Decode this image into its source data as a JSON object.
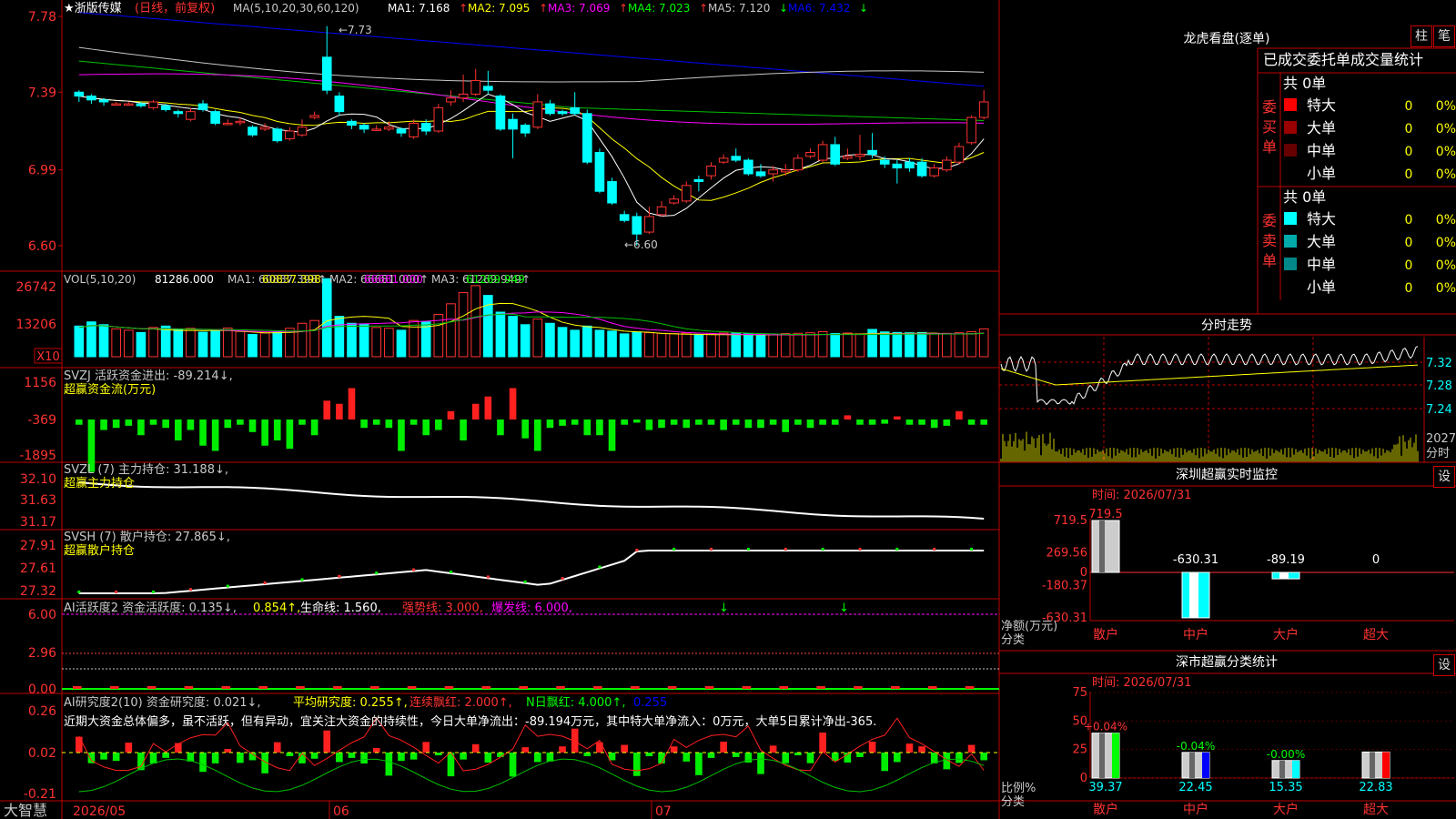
{
  "app": {
    "name": "大智慧"
  },
  "main": {
    "stock_star": "★",
    "stock_name": "浙版传媒",
    "period": "(日线，前复权)",
    "ma_label": "MA(5,10,20,30,60,120)",
    "ma": [
      {
        "name": "MA1",
        "value": "7.168",
        "arrow": "↑",
        "color": "#ffffff"
      },
      {
        "name": "MA2",
        "value": "7.095",
        "arrow": "↑",
        "color": "#ffff00"
      },
      {
        "name": "MA3",
        "value": "7.069",
        "arrow": "↑",
        "color": "#ff00ff"
      },
      {
        "name": "MA4",
        "value": "7.023",
        "arrow": "↑",
        "color": "#00ff00"
      },
      {
        "name": "MA5",
        "value": "7.120",
        "arrow": "↓",
        "color": "#c8c8c8"
      },
      {
        "name": "MA6",
        "value": "7.432",
        "arrow": "↓",
        "color": "#0000ff"
      }
    ],
    "y_ticks": [
      "7.78",
      "7.39",
      "6.99",
      "6.60"
    ],
    "high_mark": "7.73",
    "low_mark": "6.60"
  },
  "vol": {
    "label": "VOL(5,10,20)",
    "value": "81286.000",
    "ma": [
      {
        "name": "MA1",
        "value": "60837.398",
        "color": "#ffff00"
      },
      {
        "name": "MA2",
        "value": "66681.000",
        "color": "#ff00ff"
      },
      {
        "name": "MA3",
        "value": "61269.949",
        "color": "#00ff00"
      }
    ],
    "y_ticks": [
      "26742",
      "13206"
    ],
    "unit": "X10"
  },
  "svzj": {
    "label": "SVZJ  活跃资金进出: -89.214",
    "sub": "超赢资金流(万元)",
    "y_ticks": [
      "1156",
      "-369",
      "-1895"
    ]
  },
  "svzl": {
    "label": "SVZL (7) 主力持仓: 31.188",
    "sub": "超赢主力持仓",
    "y_ticks": [
      "32.10",
      "31.63",
      "31.17"
    ]
  },
  "svsh": {
    "label": "SVSH (7) 散户持仓: 27.865",
    "sub": "超赢散户持仓",
    "y_ticks": [
      "27.91",
      "27.61",
      "27.32"
    ]
  },
  "ai_active": {
    "label": "AI活跃度2 资金活跃度: 0.135",
    "v2": "0.854",
    "life": "生命线: 1.560",
    "strong": "强势线: 3.000",
    "burst": "爆发线: 6.000",
    "y_ticks": [
      "6.00",
      "2.96",
      "0.00"
    ]
  },
  "ai_research": {
    "label": "AI研究度2(10) 资金研究度: 0.021",
    "avg": "平均研究度: 0.255",
    "red": "连续飘红: 2.000",
    "nred": "N日飘红: 4.000",
    "last": "0.255",
    "desc": "近期大资金总体偏多，虽不活跃，但有异动，宜关注大资金的持续性，今日大单净流出：-89.194万元，其中特大单净流入：0万元，大单5日累计净出-365.",
    "y_ticks": [
      "0.26",
      "0.02",
      "-0.21"
    ]
  },
  "x_axis": [
    "2026/05",
    "06",
    "07"
  ],
  "right": {
    "tiger_title": "龙虎看盘(逐单)",
    "btn_zhu": "柱",
    "btn_bi": "笔",
    "stat_title": "已成交委托单成交量统计",
    "buy_label": "委买单",
    "sell_label": "委卖单",
    "buy_total": "共 0单",
    "sell_total": "共 0单",
    "buy_rows": [
      {
        "name": "特大",
        "count": "0",
        "pct": "0%",
        "color": "#ff0000"
      },
      {
        "name": "大单",
        "count": "0",
        "pct": "0%",
        "color": "#990000"
      },
      {
        "name": "中单",
        "count": "0",
        "pct": "0%",
        "color": "#660000"
      },
      {
        "name": "小单",
        "count": "0",
        "pct": "0%",
        "color": "#000000"
      }
    ],
    "sell_rows": [
      {
        "name": "特大",
        "count": "0",
        "pct": "0%",
        "color": "#00ffff"
      },
      {
        "name": "大单",
        "count": "0",
        "pct": "0%",
        "color": "#00aaaa"
      },
      {
        "name": "中单",
        "count": "0",
        "pct": "0%",
        "color": "#008888"
      },
      {
        "name": "小单",
        "count": "0",
        "pct": "0%",
        "color": "#000000"
      }
    ],
    "intraday_title": "分时走势",
    "intraday_ticks": [
      "7.32",
      "7.28",
      "7.24"
    ],
    "intraday_vol": "2027",
    "intraday_vol_unit": "分时",
    "monitor_title": "深圳超赢实时监控",
    "monitor_btn": "设",
    "monitor_time": "时间: 2026/07/31",
    "monitor_ticks": [
      "719.5",
      "269.56",
      "0",
      "-180.37",
      "-630.31"
    ],
    "monitor_bars": [
      {
        "label": "散户",
        "value": "719.5",
        "num": 719.5
      },
      {
        "label": "中户",
        "value": "-630.31",
        "num": -630.31
      },
      {
        "label": "大户",
        "value": "-89.19",
        "num": -89.19
      },
      {
        "label": "超大",
        "value": "0",
        "num": 0
      }
    ],
    "monitor_unit": "净额(万元)",
    "monitor_unit2": "分类",
    "class_title": "深市超赢分类统计",
    "class_btn": "设",
    "class_time": "时间: 2026/07/31",
    "class_ticks": [
      "75",
      "50",
      "25",
      "0"
    ],
    "class_bars": [
      {
        "label": "散户",
        "value": "39.37",
        "num": 39.37,
        "delta": "+0.04%",
        "color": "#00ff00",
        "dcolor": "#ff3333"
      },
      {
        "label": "中户",
        "value": "22.45",
        "num": 22.45,
        "delta": "-0.04%",
        "color": "#0000ff",
        "dcolor": "#00ff00"
      },
      {
        "label": "大户",
        "value": "15.35",
        "num": 15.35,
        "delta": "-0.00%",
        "color": "#00ffff",
        "dcolor": "#00ff00"
      },
      {
        "label": "超大",
        "value": "22.83",
        "num": 22.83,
        "delta": "",
        "color": "#ff0000",
        "dcolor": "#00ff00"
      }
    ],
    "class_unit": "比例%",
    "class_unit2": "分类"
  },
  "chart_data": {
    "type": "candlestick",
    "x_start": "2026/05",
    "candles": [
      [
        7.39,
        7.37,
        7.4,
        7.34
      ],
      [
        7.37,
        7.35,
        7.38,
        7.33
      ],
      [
        7.35,
        7.34,
        7.36,
        7.32
      ],
      [
        7.33,
        7.33,
        7.34,
        7.32
      ],
      [
        7.33,
        7.33,
        7.34,
        7.32
      ],
      [
        7.33,
        7.32,
        7.34,
        7.31
      ],
      [
        7.31,
        7.34,
        7.35,
        7.3
      ],
      [
        7.32,
        7.3,
        7.33,
        7.29
      ],
      [
        7.29,
        7.28,
        7.3,
        7.26
      ],
      [
        7.25,
        7.29,
        7.31,
        7.24
      ],
      [
        7.33,
        7.3,
        7.35,
        7.29
      ],
      [
        7.29,
        7.23,
        7.3,
        7.22
      ],
      [
        7.23,
        7.23,
        7.25,
        7.22
      ],
      [
        7.24,
        7.24,
        7.26,
        7.22
      ],
      [
        7.21,
        7.17,
        7.22,
        7.16
      ],
      [
        7.2,
        7.21,
        7.23,
        7.19
      ],
      [
        7.2,
        7.14,
        7.21,
        7.13
      ],
      [
        7.15,
        7.19,
        7.21,
        7.14
      ],
      [
        7.17,
        7.21,
        7.25,
        7.16
      ],
      [
        7.26,
        7.27,
        7.29,
        7.25
      ],
      [
        7.57,
        7.4,
        7.73,
        7.38
      ],
      [
        7.37,
        7.29,
        7.39,
        7.27
      ],
      [
        7.24,
        7.22,
        7.25,
        7.2
      ],
      [
        7.22,
        7.2,
        7.23,
        7.18
      ],
      [
        7.2,
        7.2,
        7.22,
        7.19
      ],
      [
        7.2,
        7.21,
        7.24,
        7.19
      ],
      [
        7.2,
        7.18,
        7.21,
        7.16
      ],
      [
        7.16,
        7.23,
        7.25,
        7.15
      ],
      [
        7.23,
        7.19,
        7.25,
        7.17
      ],
      [
        7.19,
        7.31,
        7.33,
        7.18
      ],
      [
        7.34,
        7.36,
        7.4,
        7.32
      ],
      [
        7.36,
        7.38,
        7.48,
        7.34
      ],
      [
        7.38,
        7.45,
        7.51,
        7.37
      ],
      [
        7.42,
        7.4,
        7.5,
        7.38
      ],
      [
        7.37,
        7.2,
        7.38,
        7.19
      ],
      [
        7.25,
        7.2,
        7.28,
        7.05
      ],
      [
        7.22,
        7.18,
        7.23,
        7.16
      ],
      [
        7.21,
        7.34,
        7.38,
        7.2
      ],
      [
        7.33,
        7.28,
        7.35,
        7.27
      ],
      [
        7.29,
        7.28,
        7.3,
        7.27
      ],
      [
        7.31,
        7.28,
        7.39,
        7.27
      ],
      [
        7.28,
        7.03,
        7.3,
        7.02
      ],
      [
        7.08,
        6.88,
        7.1,
        6.87
      ],
      [
        6.93,
        6.82,
        6.95,
        6.81
      ],
      [
        6.76,
        6.73,
        6.78,
        6.72
      ],
      [
        6.75,
        6.66,
        6.77,
        6.6
      ],
      [
        6.67,
        6.75,
        6.8,
        6.66
      ],
      [
        6.76,
        6.8,
        6.83,
        6.75
      ],
      [
        6.82,
        6.84,
        6.86,
        6.81
      ],
      [
        6.83,
        6.91,
        6.93,
        6.82
      ],
      [
        6.94,
        6.93,
        6.96,
        6.88
      ],
      [
        6.96,
        7.01,
        7.03,
        6.94
      ],
      [
        7.03,
        7.05,
        7.07,
        7.02
      ],
      [
        7.06,
        7.04,
        7.1,
        7.03
      ],
      [
        7.04,
        6.97,
        7.05,
        6.96
      ],
      [
        6.98,
        6.96,
        7.02,
        6.95
      ],
      [
        6.97,
        6.99,
        7.01,
        6.93
      ],
      [
        6.98,
        6.99,
        7.02,
        6.96
      ],
      [
        6.99,
        7.05,
        7.07,
        6.98
      ],
      [
        7.06,
        7.08,
        7.1,
        7.05
      ],
      [
        7.04,
        7.12,
        7.14,
        7.03
      ],
      [
        7.12,
        7.02,
        7.16,
        7.01
      ],
      [
        7.05,
        7.06,
        7.1,
        7.04
      ],
      [
        7.06,
        7.07,
        7.17,
        7.04
      ],
      [
        7.09,
        7.07,
        7.18,
        7.05
      ],
      [
        7.04,
        7.02,
        7.06,
        7.0
      ],
      [
        7.02,
        7.0,
        7.04,
        6.92
      ],
      [
        7.03,
        7.0,
        7.05,
        6.98
      ],
      [
        7.03,
        6.96,
        7.05,
        6.95
      ],
      [
        6.96,
        7.0,
        7.02,
        6.95
      ],
      [
        6.99,
        7.04,
        7.06,
        6.98
      ],
      [
        7.03,
        7.11,
        7.13,
        7.02
      ],
      [
        7.13,
        7.26,
        7.27,
        7.12
      ],
      [
        7.26,
        7.34,
        7.4,
        7.25
      ]
    ]
  }
}
